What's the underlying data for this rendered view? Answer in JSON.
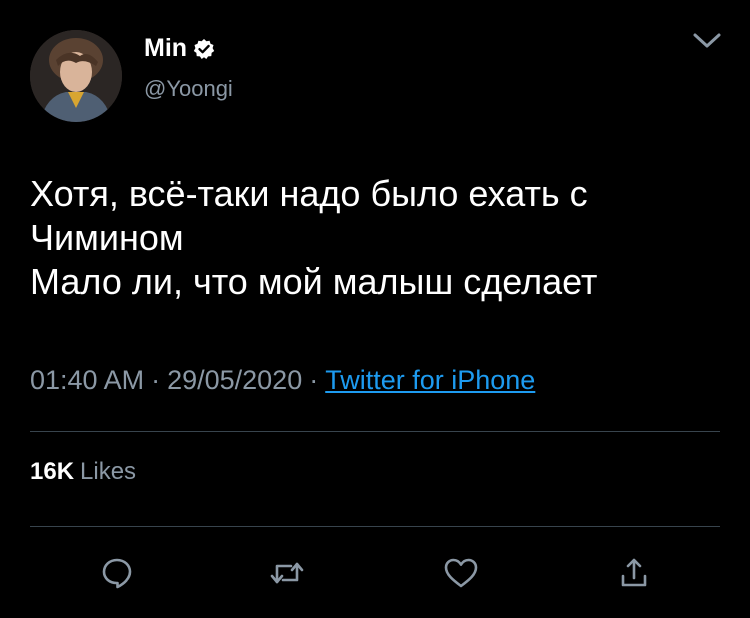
{
  "tweet": {
    "display_name": "Min",
    "handle": "@Yoongi",
    "verified": true,
    "text_lines": [
      "Хотя, всё-таки надо было ехать с",
      "Чимином",
      "Мало ли, что мой малыш сделает"
    ],
    "time": "01:40 AM",
    "date": "29/05/2020",
    "separator": "·",
    "source": "Twitter for iPhone",
    "likes_count": "16K",
    "likes_label": "Likes"
  },
  "icons": {
    "verified": "verified-badge-icon",
    "menu": "chevron-down-icon",
    "reply": "reply-bubble-icon",
    "retweet": "retweet-icon",
    "like": "heart-icon",
    "share": "share-icon"
  },
  "colors": {
    "background": "#000000",
    "text_primary": "#ffffff",
    "text_secondary": "#8b98a5",
    "link": "#1d9bf0",
    "divider": "#38444d"
  }
}
